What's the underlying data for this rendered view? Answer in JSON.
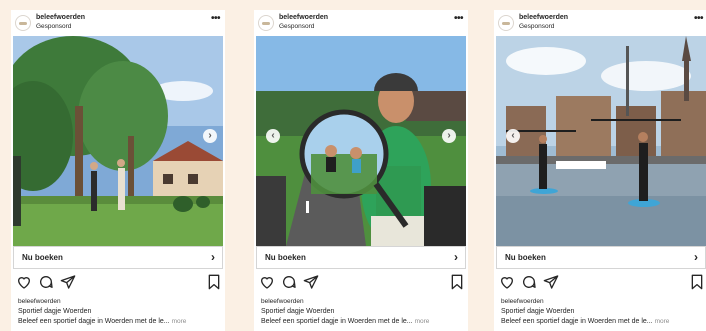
{
  "posts": [
    {
      "username": "beleefwoerden",
      "sponsored": "Gesponsord",
      "cta": "Nu boeken",
      "caption_user": "beleefwoerden",
      "caption_title": "Sportief dagje Woerden",
      "caption_text": "Beleef een sportief dagje in Woerden met de le...",
      "caption_more": "more",
      "photo": "group-outdoor-park-activity"
    },
    {
      "username": "beleefwoerden",
      "sponsored": "Gesponsord",
      "cta": "Nu boeken",
      "caption_user": "beleefwoerden",
      "caption_title": "Sportief dagje Woerden",
      "caption_text": "Beleef een sportief dagje in Woerden met de le...",
      "caption_more": "more",
      "photo": "cyclist-with-magnifier"
    },
    {
      "username": "beleefwoerden",
      "sponsored": "Gesponsord",
      "cta": "Nu boeken",
      "caption_user": "beleefwoerden",
      "caption_title": "Sportief dagje Woerden",
      "caption_text": "Beleef een sportief dagje in Woerden met de le...",
      "caption_more": "more",
      "photo": "paddleboarding-in-canal"
    }
  ],
  "icons": [
    "heart-icon",
    "comment-icon",
    "share-icon",
    "bookmark-icon",
    "more-options-icon",
    "chevron-right-icon",
    "chevron-left-icon"
  ],
  "colors": {
    "background": "#fbf0e4",
    "card": "#ffffff",
    "text": "#262626",
    "muted": "#8e8e8e"
  }
}
